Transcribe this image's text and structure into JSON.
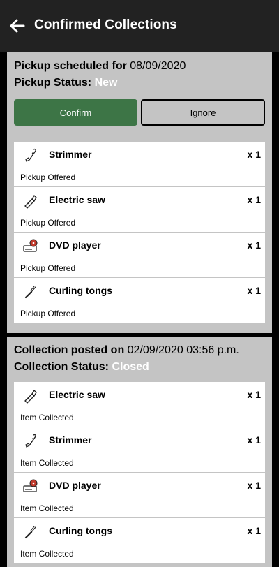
{
  "header": {
    "title": "Confirmed Collections",
    "back_icon": "arrow-left-icon"
  },
  "cards": [
    {
      "heading_label": "Pickup scheduled for",
      "heading_value": "08/09/2020",
      "status_label": "Pickup Status:",
      "status_value": "New",
      "confirm_label": "Confirm",
      "ignore_label": "Ignore",
      "items": [
        {
          "name": "Strimmer",
          "qty": "x 1",
          "status": "Pickup Offered",
          "icon": "strimmer-icon"
        },
        {
          "name": "Electric saw",
          "qty": "x 1",
          "status": "Pickup Offered",
          "icon": "electric-saw-icon"
        },
        {
          "name": "DVD player",
          "qty": "x 1",
          "status": "Pickup Offered",
          "icon": "dvd-player-icon"
        },
        {
          "name": "Curling tongs",
          "qty": "x 1",
          "status": "Pickup Offered",
          "icon": "curling-tongs-icon"
        }
      ]
    },
    {
      "heading_label": "Collection posted on",
      "heading_value": "02/09/2020 03:56 p.m.",
      "status_label": "Collection Status:",
      "status_value": "Closed",
      "items": [
        {
          "name": "Electric saw",
          "qty": "x 1",
          "status": "Item Collected",
          "icon": "electric-saw-icon"
        },
        {
          "name": "Strimmer",
          "qty": "x 1",
          "status": "Item Collected",
          "icon": "strimmer-icon"
        },
        {
          "name": "DVD player",
          "qty": "x 1",
          "status": "Item Collected",
          "icon": "dvd-player-icon"
        },
        {
          "name": "Curling tongs",
          "qty": "x 1",
          "status": "Item Collected",
          "icon": "curling-tongs-icon"
        }
      ]
    }
  ],
  "colors": {
    "app_bar": "#222222",
    "card": "#c4c4c4",
    "confirm": "#3d7546"
  }
}
